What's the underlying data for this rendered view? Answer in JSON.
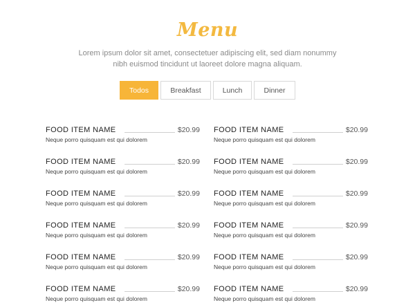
{
  "header": {
    "title": "Menu",
    "subtitle_line1": "Lorem ipsum dolor sit amet, consectetuer adipiscing elit, sed diam nonummy",
    "subtitle_line2": "nibh euismod tincidunt ut laoreet dolore magna aliquam."
  },
  "tabs": [
    {
      "label": "Todos",
      "active": true
    },
    {
      "label": "Breakfast",
      "active": false
    },
    {
      "label": "Lunch",
      "active": false
    },
    {
      "label": "Dinner",
      "active": false
    }
  ],
  "colors": {
    "accent": "#f7b538",
    "title": "#f3b940"
  },
  "menu": {
    "items": [
      {
        "name": "FOOD ITEM NAME",
        "price": "$20.99",
        "description": "Neque porro quisquam est qui dolorem"
      },
      {
        "name": "FOOD ITEM NAME",
        "price": "$20.99",
        "description": "Neque porro quisquam est qui dolorem"
      },
      {
        "name": "FOOD ITEM NAME",
        "price": "$20.99",
        "description": "Neque porro quisquam est qui dolorem"
      },
      {
        "name": "FOOD ITEM NAME",
        "price": "$20.99",
        "description": "Neque porro quisquam est qui dolorem"
      },
      {
        "name": "FOOD ITEM NAME",
        "price": "$20.99",
        "description": "Neque porro quisquam est qui dolorem"
      },
      {
        "name": "FOOD ITEM NAME",
        "price": "$20.99",
        "description": "Neque porro quisquam est qui dolorem"
      },
      {
        "name": "FOOD ITEM NAME",
        "price": "$20.99",
        "description": "Neque porro quisquam est qui dolorem"
      },
      {
        "name": "FOOD ITEM NAME",
        "price": "$20.99",
        "description": "Neque porro quisquam est qui dolorem"
      },
      {
        "name": "FOOD ITEM NAME",
        "price": "$20.99",
        "description": "Neque porro quisquam est qui dolorem"
      },
      {
        "name": "FOOD ITEM NAME",
        "price": "$20.99",
        "description": "Neque porro quisquam est qui dolorem"
      },
      {
        "name": "FOOD ITEM NAME",
        "price": "$20.99",
        "description": "Neque porro quisquam est qui dolorem"
      },
      {
        "name": "FOOD ITEM NAME",
        "price": "$20.99",
        "description": "Neque porro quisquam est qui dolorem"
      }
    ]
  }
}
